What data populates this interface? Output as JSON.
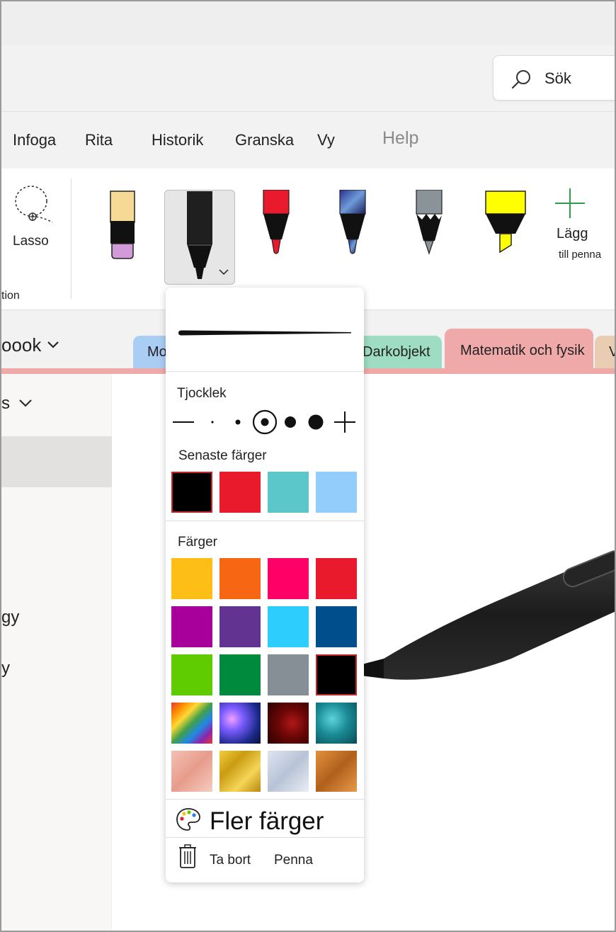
{
  "search": {
    "label": "Sök"
  },
  "menu": {
    "items": [
      "Infoga",
      "Rita",
      "Historik",
      "Granska",
      "Vy",
      "Help"
    ]
  },
  "ribbon": {
    "lasso_label": "Lasso",
    "group_label_partial": "tion",
    "add_pen_line1": "Lägg",
    "add_pen_line2": "till penna"
  },
  "notebook": {
    "title_partial": "oook"
  },
  "tabs": [
    {
      "label": "Mo",
      "color": "#a9cdf3"
    },
    {
      "label": "Darkobjekt",
      "color": "#9fdcc4"
    },
    {
      "label": "Matematik och fysik",
      "color": "#f0a9a9"
    },
    {
      "label": "V",
      "color": "#e9cdb2"
    }
  ],
  "sidebar": {
    "section_partial": "s",
    "item1_partial": "gy",
    "item2_partial": "y"
  },
  "popup": {
    "thickness_label": "Tjocklek",
    "recent_label": "Senaste färger",
    "recent_colors": [
      "#000000",
      "#e81a2c",
      "#5bc7ca",
      "#92cdfb"
    ],
    "colors_label": "Färger",
    "colors": [
      [
        "#fdbf16",
        "#f76613",
        "#fe0066",
        "#e81a2c"
      ],
      [
        "#a7009b",
        "#633391",
        "#2dcdfe",
        "#004e8c"
      ],
      [
        "#60cc00",
        "#008a3e",
        "#868f96",
        "#000000"
      ]
    ],
    "textures": [
      "rainbow",
      "galaxy",
      "lava",
      "teal",
      "rose-gold",
      "gold",
      "silver",
      "bronze"
    ],
    "more_colors": "Fler färger",
    "delete": "Ta bort",
    "pen": "Penna"
  }
}
